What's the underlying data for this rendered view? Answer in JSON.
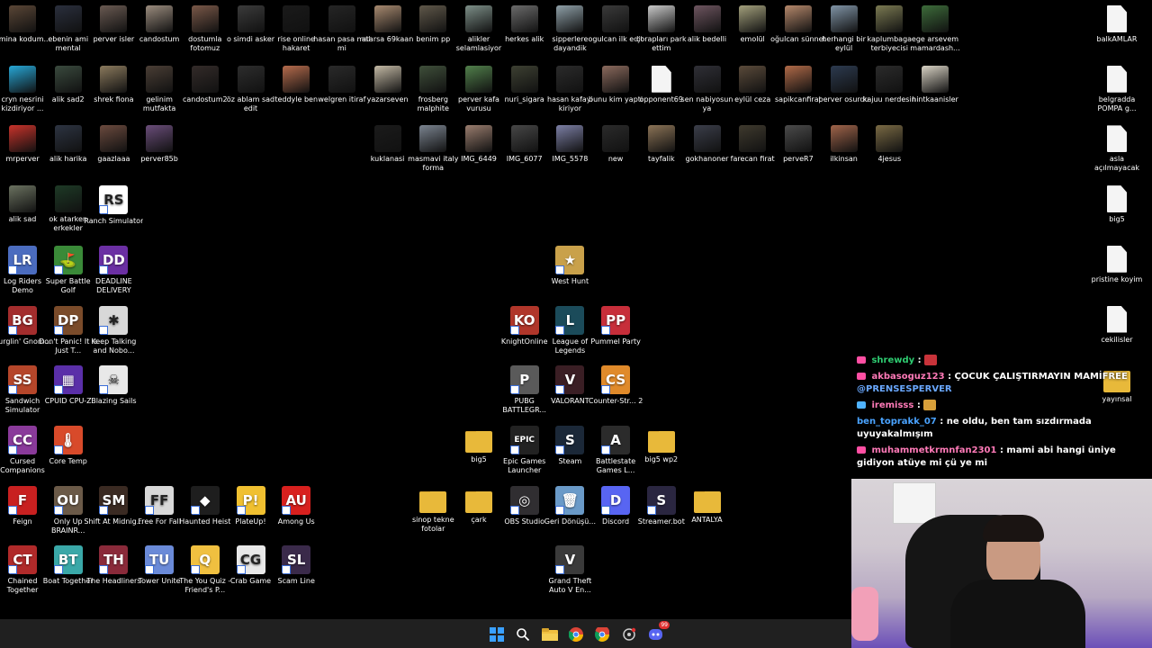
{
  "desktop_icons": [
    {
      "label": "amina kodum...",
      "col": 0,
      "row": 0,
      "kind": "photo",
      "color": "#5a4636"
    },
    {
      "label": "ebenin ami mental",
      "col": 1,
      "row": 0,
      "kind": "photo",
      "color": "#2a2f3d"
    },
    {
      "label": "perver isler",
      "col": 2,
      "row": 0,
      "kind": "photo",
      "color": "#6a5a52"
    },
    {
      "label": "candostum",
      "col": 3,
      "row": 0,
      "kind": "photo",
      "color": "#9b8c7e"
    },
    {
      "label": "dostumla fotomuz",
      "col": 4,
      "row": 0,
      "kind": "photo",
      "color": "#7a5848"
    },
    {
      "label": "o simdi asker",
      "col": 5,
      "row": 0,
      "kind": "photo",
      "color": "#3b3b3b"
    },
    {
      "label": "rise online hakaret",
      "col": 6,
      "row": 0,
      "kind": "photo",
      "color": "#1a1a1a"
    },
    {
      "label": "hasan pasa mal mi",
      "col": 7,
      "row": 0,
      "kind": "photo",
      "color": "#252525"
    },
    {
      "label": "atarsa 69kaan",
      "col": 8,
      "row": 0,
      "kind": "photo",
      "color": "#a88a70"
    },
    {
      "label": "benim pp",
      "col": 9,
      "row": 0,
      "kind": "photo",
      "color": "#60584a"
    },
    {
      "label": "alikler selamlasiyor",
      "col": 10,
      "row": 0,
      "kind": "photo",
      "color": "#7d8f88"
    },
    {
      "label": "herkes alik",
      "col": 11,
      "row": 0,
      "kind": "photo",
      "color": "#6b6b6b"
    },
    {
      "label": "sipperlere dayandik",
      "col": 12,
      "row": 0,
      "kind": "photo",
      "color": "#8fa0a8"
    },
    {
      "label": "ogulcan ilk edit",
      "col": 13,
      "row": 0,
      "kind": "photo",
      "color": "#3a3a3a"
    },
    {
      "label": "çorapları park ettim",
      "col": 14,
      "row": 0,
      "kind": "photo",
      "color": "#c9c9c9"
    },
    {
      "label": "alik bedelli",
      "col": 15,
      "row": 0,
      "kind": "photo",
      "color": "#6e5560"
    },
    {
      "label": "emolül",
      "col": 16,
      "row": 0,
      "kind": "photo",
      "color": "#a3a07c"
    },
    {
      "label": "oğulcan sünnet",
      "col": 17,
      "row": 0,
      "kind": "photo",
      "color": "#b5886b"
    },
    {
      "label": "herhangi bir eylül",
      "col": 18,
      "row": 0,
      "kind": "photo",
      "color": "#8094a6"
    },
    {
      "label": "kaplumbaga terbiyecisi",
      "col": 19,
      "row": 0,
      "kind": "photo",
      "color": "#7b7a52"
    },
    {
      "label": "ege arsevem mamardash...",
      "col": 20,
      "row": 0,
      "kind": "photo",
      "color": "#3d6c3a"
    },
    {
      "label": "cryn nesrini kizdiriyor ...",
      "col": 0,
      "row": 1,
      "kind": "photo",
      "color": "#27a7d6"
    },
    {
      "label": "alik sad2",
      "col": 1,
      "row": 1,
      "kind": "photo",
      "color": "#3a4a3e"
    },
    {
      "label": "shrek fiona",
      "col": 2,
      "row": 1,
      "kind": "photo",
      "color": "#8b7a5d"
    },
    {
      "label": "gelinim mutfakta",
      "col": 3,
      "row": 1,
      "kind": "photo",
      "color": "#4a3e35"
    },
    {
      "label": "candostum2",
      "col": 4,
      "row": 1,
      "kind": "photo",
      "color": "#332b29"
    },
    {
      "label": "öz ablam sad edit",
      "col": 5,
      "row": 1,
      "kind": "photo",
      "color": "#2d2d2d"
    },
    {
      "label": "teddyle ben",
      "col": 6,
      "row": 1,
      "kind": "photo",
      "color": "#b56b4c"
    },
    {
      "label": "welgren itiraf",
      "col": 7,
      "row": 1,
      "kind": "photo",
      "color": "#2a2a2a"
    },
    {
      "label": "yazarseven",
      "col": 8,
      "row": 1,
      "kind": "photo",
      "color": "#c3b9a5"
    },
    {
      "label": "frosberg malphite",
      "col": 9,
      "row": 1,
      "kind": "photo",
      "color": "#3f4f3a"
    },
    {
      "label": "perver kafa vurusu",
      "col": 10,
      "row": 1,
      "kind": "photo",
      "color": "#51804b"
    },
    {
      "label": "nuri_sigara",
      "col": 11,
      "row": 1,
      "kind": "photo",
      "color": "#3d4032"
    },
    {
      "label": "hasan kafayi kiriyor",
      "col": 12,
      "row": 1,
      "kind": "photo",
      "color": "#2b2b2b"
    },
    {
      "label": "bunu kim yapti",
      "col": 13,
      "row": 1,
      "kind": "photo",
      "color": "#8b6a5d"
    },
    {
      "label": "opponent69",
      "col": 14,
      "row": 1,
      "kind": "doc",
      "color": "#f4f4f4"
    },
    {
      "label": "sen nabiyosun ya",
      "col": 15,
      "row": 1,
      "kind": "photo",
      "color": "#2f2f36"
    },
    {
      "label": "eylül ceza",
      "col": 16,
      "row": 1,
      "kind": "photo",
      "color": "#5a4a3a"
    },
    {
      "label": "sapikcanfirat",
      "col": 17,
      "row": 1,
      "kind": "photo",
      "color": "#b06a48"
    },
    {
      "label": "perver osurdu",
      "col": 18,
      "row": 1,
      "kind": "photo",
      "color": "#2c3a4f"
    },
    {
      "label": "kajuu nerdesin",
      "col": 19,
      "row": 1,
      "kind": "photo",
      "color": "#2b2b2b"
    },
    {
      "label": "hintkaanisler",
      "col": 20,
      "row": 1,
      "kind": "photo",
      "color": "#d8d2c4"
    },
    {
      "label": "mrperver",
      "col": 0,
      "row": 2,
      "kind": "photo",
      "color": "#c8332b"
    },
    {
      "label": "alik harika",
      "col": 1,
      "row": 2,
      "kind": "photo",
      "color": "#2d3442"
    },
    {
      "label": "gaazlaaa",
      "col": 2,
      "row": 2,
      "kind": "photo",
      "color": "#6b4a3e"
    },
    {
      "label": "perver85b",
      "col": 3,
      "row": 2,
      "kind": "photo",
      "color": "#6a4d7a"
    },
    {
      "label": "kuklanasi",
      "col": 8,
      "row": 2,
      "kind": "photo",
      "color": "#1b1b1b"
    },
    {
      "label": "masmavi italy forma",
      "col": 9,
      "row": 2,
      "kind": "photo",
      "color": "#7b8490"
    },
    {
      "label": "IMG_6449",
      "col": 10,
      "row": 2,
      "kind": "photo",
      "color": "#9a7d6e"
    },
    {
      "label": "IMG_6077",
      "col": 11,
      "row": 2,
      "kind": "photo",
      "color": "#474747"
    },
    {
      "label": "IMG_5578",
      "col": 12,
      "row": 2,
      "kind": "photo",
      "color": "#7c7fa5"
    },
    {
      "label": "new",
      "col": 13,
      "row": 2,
      "kind": "photo",
      "color": "#2b2b2b"
    },
    {
      "label": "tayfalik",
      "col": 14,
      "row": 2,
      "kind": "photo",
      "color": "#8b7356"
    },
    {
      "label": "gokhanoner",
      "col": 15,
      "row": 2,
      "kind": "photo",
      "color": "#3b3e4a"
    },
    {
      "label": "farecan firat",
      "col": 16,
      "row": 2,
      "kind": "photo",
      "color": "#3f3a2e"
    },
    {
      "label": "perveR7",
      "col": 17,
      "row": 2,
      "kind": "photo",
      "color": "#4b4b4b"
    },
    {
      "label": "ilkinsan",
      "col": 18,
      "row": 2,
      "kind": "photo",
      "color": "#a0644a"
    },
    {
      "label": "4jesus",
      "col": 19,
      "row": 2,
      "kind": "photo",
      "color": "#7a6a44"
    },
    {
      "label": "alik sad",
      "col": 0,
      "row": 3,
      "kind": "photo",
      "color": "#6b7260"
    },
    {
      "label": "ok atarken erkekler",
      "col": 1,
      "row": 3,
      "kind": "photo",
      "color": "#1e3a26"
    },
    {
      "label": "Ranch Simulator",
      "col": 2,
      "row": 3,
      "kind": "app",
      "color": "#ffffff",
      "glyph": "RS"
    },
    {
      "label": "Log Riders Demo",
      "col": 0,
      "row": 4,
      "kind": "app",
      "color": "#4b6cbf",
      "glyph": "LR"
    },
    {
      "label": "Super Battle Golf",
      "col": 1,
      "row": 4,
      "kind": "app",
      "color": "#3a8a38",
      "glyph": "⛳"
    },
    {
      "label": "DEADLINE DELIVERY",
      "col": 2,
      "row": 4,
      "kind": "app",
      "color": "#6b2fa3",
      "glyph": "DD"
    },
    {
      "label": "West Hunt",
      "col": 12,
      "row": 4,
      "kind": "app",
      "color": "#c9a14a",
      "glyph": "★"
    },
    {
      "label": "Burglin' Gnom...",
      "col": 0,
      "row": 5,
      "kind": "app",
      "color": "#a32d2d",
      "glyph": "BG"
    },
    {
      "label": "Don't Panic! It is Just T...",
      "col": 1,
      "row": 5,
      "kind": "app",
      "color": "#7a4b2a",
      "glyph": "DP"
    },
    {
      "label": "Keep Talking and Nobo...",
      "col": 2,
      "row": 5,
      "kind": "app",
      "color": "#d8d8d8",
      "glyph": "✱"
    },
    {
      "label": "KnightOnline",
      "col": 11,
      "row": 5,
      "kind": "app",
      "color": "#b0362a",
      "glyph": "KO"
    },
    {
      "label": "League of Legends",
      "col": 12,
      "row": 5,
      "kind": "app",
      "color": "#1b4b5a",
      "glyph": "L"
    },
    {
      "label": "Pummel Party",
      "col": 13,
      "row": 5,
      "kind": "app",
      "color": "#c72e3a",
      "glyph": "PP"
    },
    {
      "label": "Sandwich Simulator",
      "col": 0,
      "row": 6,
      "kind": "app",
      "color": "#b5462a",
      "glyph": "SS"
    },
    {
      "label": "CPUID CPU-Z",
      "col": 1,
      "row": 6,
      "kind": "app",
      "color": "#5a2fa8",
      "glyph": "▦"
    },
    {
      "label": "Blazing Sails",
      "col": 2,
      "row": 6,
      "kind": "app",
      "color": "#e8e8e8",
      "glyph": "☠"
    },
    {
      "label": "PUBG BATTLEGR...",
      "col": 11,
      "row": 6,
      "kind": "app",
      "color": "#5a5a5a",
      "glyph": "P"
    },
    {
      "label": "VALORANT",
      "col": 12,
      "row": 6,
      "kind": "app",
      "color": "#3a1e24",
      "glyph": "V"
    },
    {
      "label": "Counter-Str... 2",
      "col": 13,
      "row": 6,
      "kind": "app",
      "color": "#e08a2a",
      "glyph": "CS"
    },
    {
      "label": "Cursed Companions",
      "col": 0,
      "row": 7,
      "kind": "app",
      "color": "#8a3a9a",
      "glyph": "CC"
    },
    {
      "label": "Core Temp",
      "col": 1,
      "row": 7,
      "kind": "app",
      "color": "#d84a2a",
      "glyph": "🌡"
    },
    {
      "label": "big5",
      "col": 10,
      "row": 7,
      "kind": "folder",
      "color": "#e8b93a"
    },
    {
      "label": "Epic Games Launcher",
      "col": 11,
      "row": 7,
      "kind": "app",
      "color": "#222222",
      "glyph": "EPIC"
    },
    {
      "label": "Steam",
      "col": 12,
      "row": 7,
      "kind": "app",
      "color": "#1b2838",
      "glyph": "S"
    },
    {
      "label": "Battlestate Games L...",
      "col": 13,
      "row": 7,
      "kind": "app",
      "color": "#2b2b2b",
      "glyph": "A"
    },
    {
      "label": "big5 wp2",
      "col": 14,
      "row": 7,
      "kind": "folder",
      "color": "#e8b93a"
    },
    {
      "label": "Feign",
      "col": 0,
      "row": 8,
      "kind": "app",
      "color": "#c82020",
      "glyph": "F"
    },
    {
      "label": "Only Up BRAINR...",
      "col": 1,
      "row": 8,
      "kind": "app",
      "color": "#6b5a48",
      "glyph": "OU"
    },
    {
      "label": "Shift At Midnig...",
      "col": 2,
      "row": 8,
      "kind": "app",
      "color": "#3a2a22",
      "glyph": "SM"
    },
    {
      "label": "Free For Fall",
      "col": 3,
      "row": 8,
      "kind": "app",
      "color": "#d8d8d8",
      "glyph": "FF"
    },
    {
      "label": "Haunted Heist",
      "col": 4,
      "row": 8,
      "kind": "app",
      "color": "#1e1e1e",
      "glyph": "◆"
    },
    {
      "label": "PlateUp!",
      "col": 5,
      "row": 8,
      "kind": "app",
      "color": "#f0c030",
      "glyph": "P!"
    },
    {
      "label": "Among Us",
      "col": 6,
      "row": 8,
      "kind": "app",
      "color": "#d8201e",
      "glyph": "AU"
    },
    {
      "label": "sinop tekne fotolar",
      "col": 9,
      "row": 8,
      "kind": "folder",
      "color": "#e8b93a"
    },
    {
      "label": "çark",
      "col": 10,
      "row": 8,
      "kind": "folder",
      "color": "#e8b93a"
    },
    {
      "label": "OBS Studio",
      "col": 11,
      "row": 8,
      "kind": "app",
      "color": "#302e31",
      "glyph": "◎"
    },
    {
      "label": "Geri Dönüşü...",
      "col": 12,
      "row": 8,
      "kind": "app",
      "color": "#6a9ac8",
      "glyph": "🗑"
    },
    {
      "label": "Discord",
      "col": 13,
      "row": 8,
      "kind": "app",
      "color": "#5865f2",
      "glyph": "D"
    },
    {
      "label": "Streamer.bot",
      "col": 14,
      "row": 8,
      "kind": "app",
      "color": "#2a2640",
      "glyph": "S"
    },
    {
      "label": "ANTALYA",
      "col": 15,
      "row": 8,
      "kind": "folder",
      "color": "#e8b93a"
    },
    {
      "label": "Chained Together",
      "col": 0,
      "row": 9,
      "kind": "app",
      "color": "#b02a2a",
      "glyph": "CT"
    },
    {
      "label": "Boat Together",
      "col": 1,
      "row": 9,
      "kind": "app",
      "color": "#3aa8a8",
      "glyph": "BT"
    },
    {
      "label": "The Headliners",
      "col": 2,
      "row": 9,
      "kind": "app",
      "color": "#8a2a3a",
      "glyph": "TH"
    },
    {
      "label": "Tower Unite",
      "col": 3,
      "row": 9,
      "kind": "app",
      "color": "#6a8ad8",
      "glyph": "TU"
    },
    {
      "label": "The You Quiz - Friend's P...",
      "col": 4,
      "row": 9,
      "kind": "app",
      "color": "#f0c040",
      "glyph": "Q"
    },
    {
      "label": "Crab Game",
      "col": 5,
      "row": 9,
      "kind": "app",
      "color": "#e8e8e8",
      "glyph": "CG"
    },
    {
      "label": "Scam Line",
      "col": 6,
      "row": 9,
      "kind": "app",
      "color": "#3a2a4a",
      "glyph": "SL"
    },
    {
      "label": "Grand Theft Auto V En...",
      "col": 12,
      "row": 9,
      "kind": "app",
      "color": "#3a3a3a",
      "glyph": "V"
    }
  ],
  "right_icons": [
    {
      "label": "balkAMLAR",
      "kind": "doc"
    },
    {
      "label": "belgradda POMPA g...",
      "kind": "doc"
    },
    {
      "label": "asla açılmayacak",
      "kind": "doc"
    },
    {
      "label": "big5",
      "kind": "doc"
    },
    {
      "label": "pristine koyim",
      "kind": "doc"
    },
    {
      "label": "cekilisler",
      "kind": "doc"
    },
    {
      "label": "yayınsal",
      "kind": "folder"
    }
  ],
  "chat": {
    "messages": [
      {
        "user": "shrewdy",
        "text": ":",
        "user_color": "#2ecc71",
        "badge": "#ff4fa3"
      },
      {
        "user": "akbasoguz123",
        "text": ": ÇOCUK ÇALIŞTIRMAYIN MAMİFREE",
        "user_color": "#ff7ab8",
        "badge": "#ff4fa3",
        "mention": "@PRENSESPERVER"
      },
      {
        "user": "iremisss",
        "text": ":",
        "user_color": "#ff7ab8",
        "badge": "#4fb3ff"
      },
      {
        "user": "ben_toprakk_07",
        "text": ": ne oldu, ben tam sızdırmada uyuyakalmışım",
        "user_color": "#4aa3ff",
        "badge": ""
      },
      {
        "user": "muhammetkrmnfan2301",
        "text": ": mami abi hangi üniye gidiyon atüye mi çü ye mi",
        "user_color": "#ff7ab8",
        "badge": "#ff4fa3"
      }
    ]
  },
  "taskbar": {
    "items": [
      "start-icon",
      "search-icon",
      "file-explorer-icon",
      "chrome-icon",
      "chrome-alt-icon",
      "settings-icon",
      "discord-icon"
    ],
    "discord_badge": "99"
  },
  "colors": {
    "desktop_bg": "#000000",
    "taskbar_bg": "#202020",
    "discord_brand": "#5865f2"
  }
}
